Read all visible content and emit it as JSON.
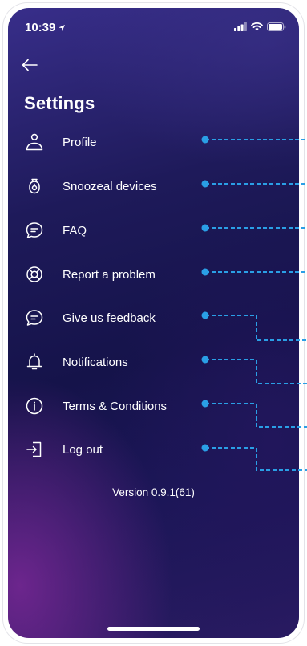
{
  "status_bar": {
    "time": "10:39"
  },
  "header": {
    "back_icon": "arrow-left-icon",
    "title": "Settings"
  },
  "menu": {
    "items": [
      {
        "label": "Profile",
        "icon": "user-icon"
      },
      {
        "label": "Snoozeal devices",
        "icon": "device-icon"
      },
      {
        "label": "FAQ",
        "icon": "chat-bubble-icon"
      },
      {
        "label": "Report a problem",
        "icon": "lifebuoy-icon"
      },
      {
        "label": "Give us feedback",
        "icon": "chat-bubble-icon"
      },
      {
        "label": "Notifications",
        "icon": "bell-icon"
      },
      {
        "label": "Terms & Conditions",
        "icon": "info-icon"
      },
      {
        "label": "Log out",
        "icon": "logout-icon"
      }
    ]
  },
  "footer": {
    "version": "Version 0.9.1(61)"
  },
  "colors": {
    "callout": "#2a9fe6",
    "text": "#ffffff"
  }
}
